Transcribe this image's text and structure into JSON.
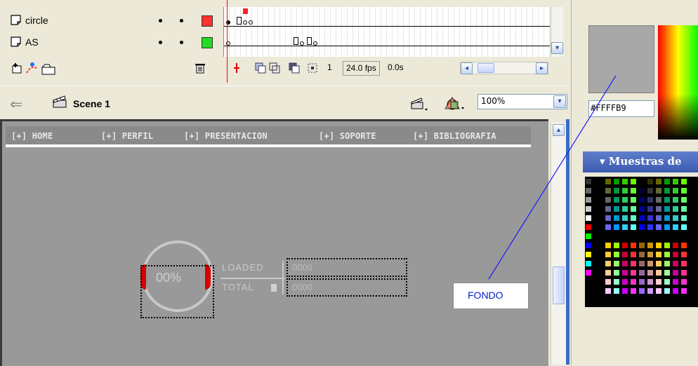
{
  "timeline": {
    "layers": [
      {
        "name": "circle",
        "color": "#ff3030"
      },
      {
        "name": "AS",
        "color": "#22dd22"
      }
    ],
    "frame_number": "1",
    "fps": "24.0 fps",
    "elapsed": "0.0s"
  },
  "scene": {
    "label": "Scene 1",
    "zoom": "100%"
  },
  "nav": {
    "items": [
      "[+] HOME",
      "[+] PERFIL",
      "[+] PRESENTACION",
      "[+] SOPORTE",
      "[+] BIBLIOGRAFIA"
    ]
  },
  "preloader": {
    "percent": "00%",
    "loaded_label": "LOADED",
    "total_label": "TOTAL",
    "loaded_value": "0000",
    "total_value": "0000"
  },
  "annotation": {
    "label": "FONDO"
  },
  "color_panel": {
    "hex": "#FFFFB9",
    "preview_color": "#a8a8a8",
    "swatches_title": "Muestras de"
  },
  "colors": {
    "stage_bg": "#999999",
    "stage_frame": "#3b6cc4",
    "annotation_text": "#0019c8",
    "connector_line": "#1a1aff"
  }
}
